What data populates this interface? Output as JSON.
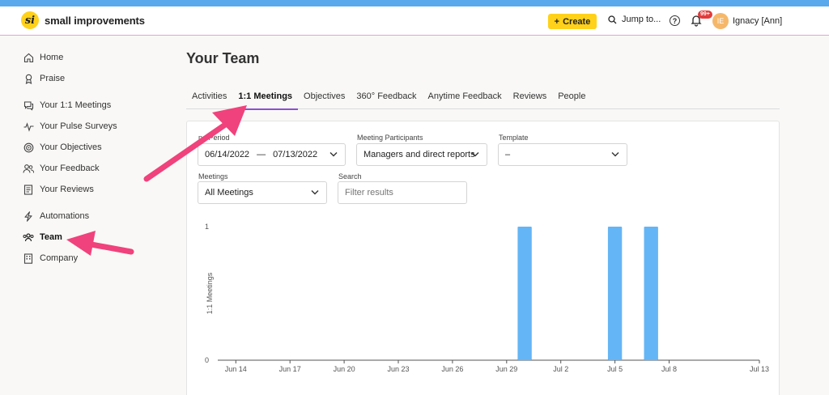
{
  "app": {
    "name": "small improvements",
    "logo_mark": "si"
  },
  "topbar": {
    "create_label": "Create",
    "create_plus": "+",
    "jump_label": "Jump to...",
    "help_glyph": "?",
    "notification_badge": "99+",
    "avatar_initials": "IE",
    "user_name": "Ignacy [Ann]",
    "colors": {
      "strip": "#5aa9ec",
      "create_bg": "#ffd11a",
      "badge": "#e23b3b",
      "avatar": "#f5b86a",
      "tab_underline": "#8a4fd2",
      "bar": "#64b5f6",
      "arrow": "#f0427c"
    }
  },
  "sidebar": {
    "groups": [
      [
        {
          "label": "Home",
          "icon": "home-icon"
        },
        {
          "label": "Praise",
          "icon": "ribbon-icon"
        }
      ],
      [
        {
          "label": "Your 1:1 Meetings",
          "icon": "chat-icon"
        },
        {
          "label": "Your Pulse Surveys",
          "icon": "pulse-icon"
        },
        {
          "label": "Your Objectives",
          "icon": "target-icon"
        },
        {
          "label": "Your Feedback",
          "icon": "people-icon"
        },
        {
          "label": "Your Reviews",
          "icon": "document-icon"
        }
      ],
      [
        {
          "label": "Automations",
          "icon": "lightning-icon"
        },
        {
          "label": "Team",
          "icon": "team-icon",
          "active": true
        },
        {
          "label": "Company",
          "icon": "building-icon"
        }
      ]
    ]
  },
  "main": {
    "title": "Your Team",
    "tabs": [
      {
        "label": "Activities"
      },
      {
        "label": "1:1 Meetings",
        "active": true
      },
      {
        "label": "Objectives"
      },
      {
        "label": "360° Feedback"
      },
      {
        "label": "Anytime Feedback"
      },
      {
        "label": "Reviews"
      },
      {
        "label": "People"
      }
    ]
  },
  "filters": {
    "period": {
      "label": "ne Period",
      "start": "06/14/2022",
      "separator": "—",
      "end": "07/13/2022"
    },
    "participants": {
      "label": "Meeting Participants",
      "value": "Managers and direct reports"
    },
    "template": {
      "label": "Template",
      "value": "–"
    },
    "meetings": {
      "label": "Meetings",
      "value": "All Meetings"
    },
    "search": {
      "label": "Search",
      "placeholder": "Filter results"
    }
  },
  "chart_data": {
    "type": "bar",
    "ylabel": "1:1 Meetings",
    "xlabel": "",
    "ylim": [
      0,
      1
    ],
    "yticks": [
      0,
      1
    ],
    "x_start": "2022-06-13",
    "x_end": "2022-07-13",
    "tick_labels": [
      {
        "date": "2022-06-14",
        "label": "Jun 14"
      },
      {
        "date": "2022-06-17",
        "label": "Jun 17"
      },
      {
        "date": "2022-06-20",
        "label": "Jun 20"
      },
      {
        "date": "2022-06-23",
        "label": "Jun 23"
      },
      {
        "date": "2022-06-26",
        "label": "Jun 26"
      },
      {
        "date": "2022-06-29",
        "label": "Jun 29"
      },
      {
        "date": "2022-07-02",
        "label": "Jul 2"
      },
      {
        "date": "2022-07-05",
        "label": "Jul 5"
      },
      {
        "date": "2022-07-08",
        "label": "Jul 8"
      },
      {
        "date": "2022-07-13",
        "label": "Jul 13"
      }
    ],
    "series": [
      {
        "values": [
          {
            "date": "2022-06-30",
            "value": 1
          },
          {
            "date": "2022-07-05",
            "value": 1
          },
          {
            "date": "2022-07-07",
            "value": 1
          }
        ]
      }
    ],
    "grid": false,
    "color": "#64b5f6"
  }
}
